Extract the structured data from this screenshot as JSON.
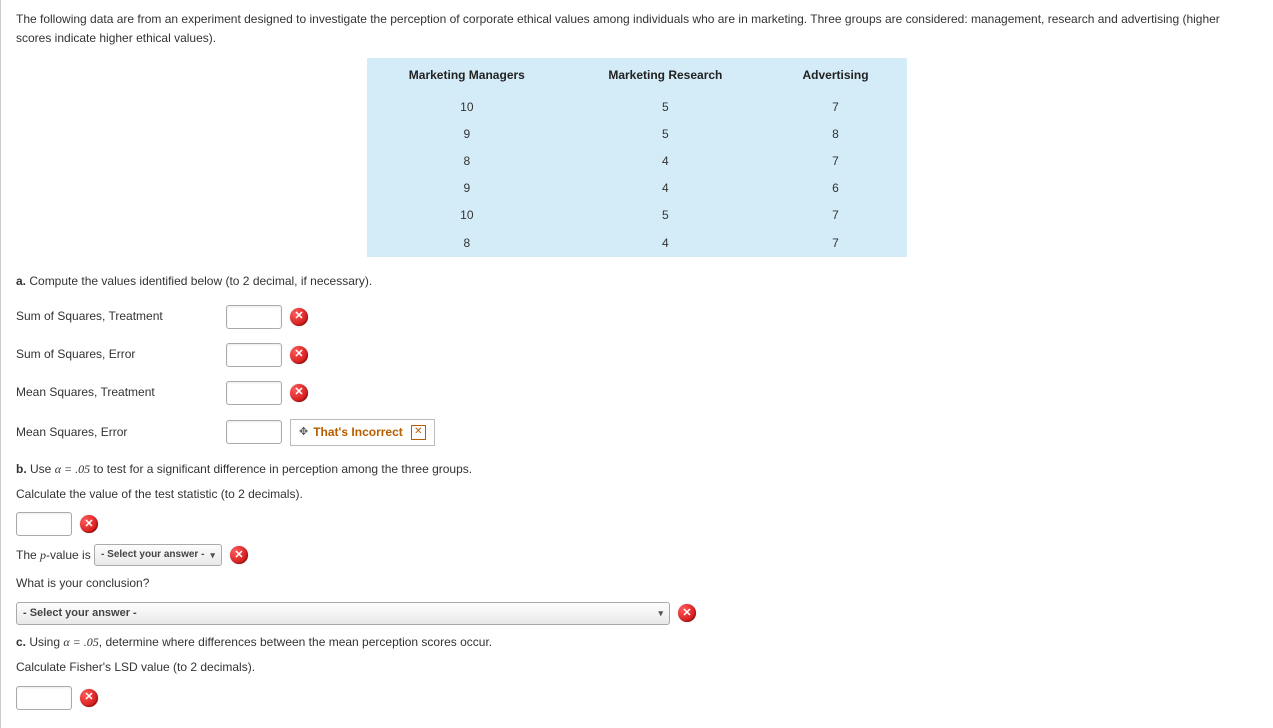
{
  "intro": "The following data are from an experiment designed to investigate the perception of corporate ethical values among individuals who are in marketing. Three groups are considered: management, research and advertising (higher scores indicate higher ethical values).",
  "table": {
    "headers": [
      "Marketing Managers",
      "Marketing Research",
      "Advertising"
    ],
    "rows": [
      [
        "10",
        "5",
        "7"
      ],
      [
        "9",
        "5",
        "8"
      ],
      [
        "8",
        "4",
        "7"
      ],
      [
        "9",
        "4",
        "6"
      ],
      [
        "10",
        "5",
        "7"
      ],
      [
        "8",
        "4",
        "7"
      ]
    ]
  },
  "partA": {
    "label": "a.",
    "text": " Compute the values identified below (to 2 decimal, if necessary).",
    "rows": [
      "Sum of Squares, Treatment",
      "Sum of Squares, Error",
      "Mean Squares, Treatment",
      "Mean Squares, Error"
    ],
    "feedback": "That's Incorrect"
  },
  "partB": {
    "label": "b.",
    "text1_prefix": " Use ",
    "alpha_expr": "α = .05",
    "text1_suffix": " to test for a significant difference in perception among the three groups.",
    "text2": "Calculate the value of the test statistic (to 2 decimals).",
    "pvalue_prefix": "The ",
    "pvar": "p",
    "pvalue_suffix": "-value is",
    "select_placeholder": "- Select your answer -",
    "conclusion_q": "What is your conclusion?"
  },
  "partC": {
    "label": "c.",
    "text_prefix": " Using ",
    "alpha_expr": "α = .05",
    "text_suffix": ", determine where differences between the mean perception scores occur.",
    "text2": "Calculate Fisher's LSD value (to 2 decimals)."
  }
}
